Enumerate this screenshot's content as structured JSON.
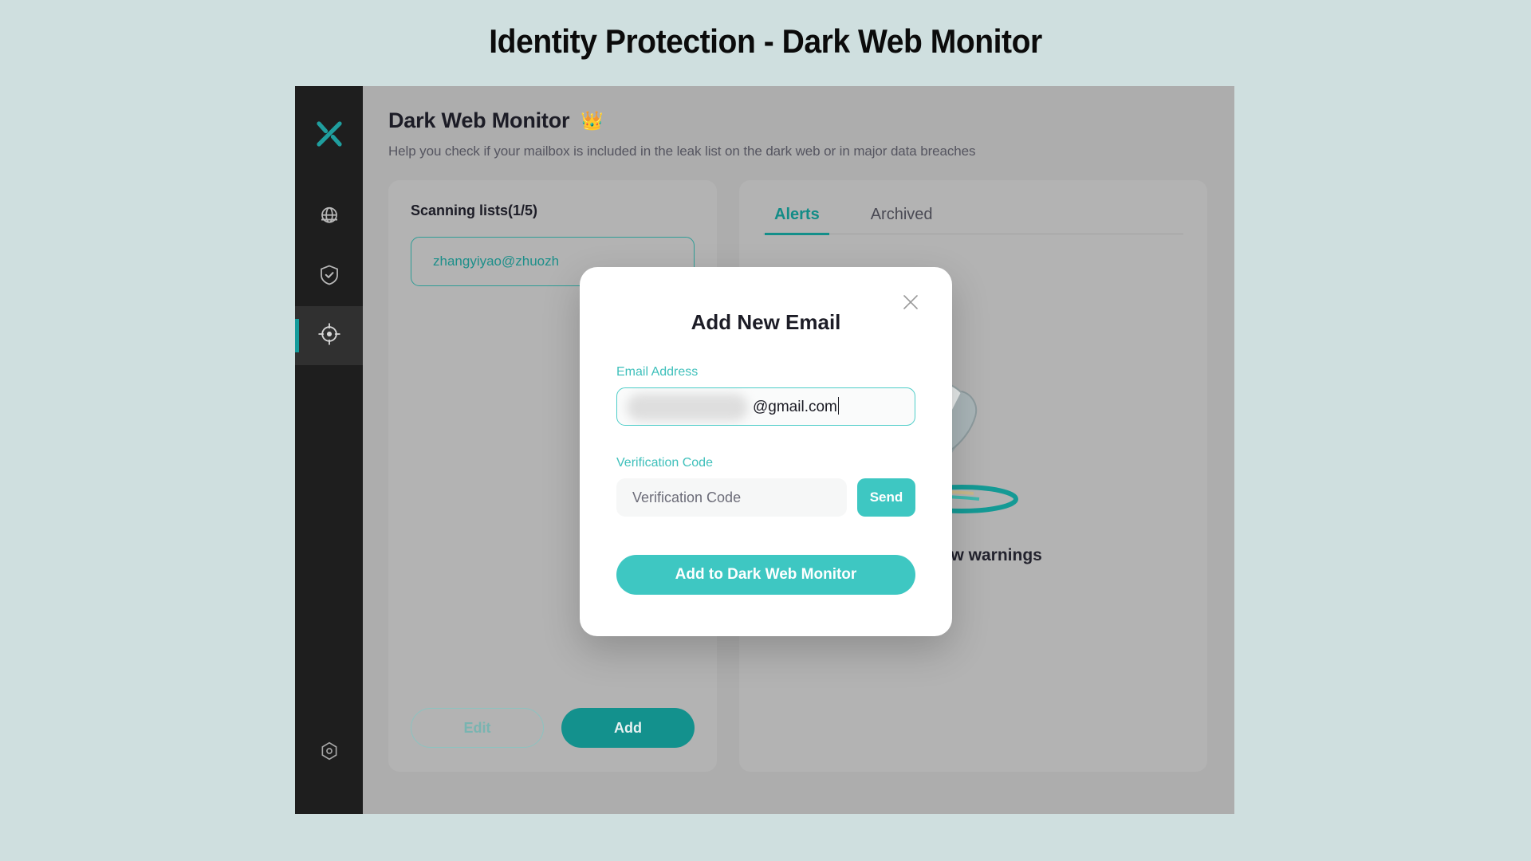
{
  "page": {
    "title": "Identity Protection - Dark Web Monitor",
    "background_color": "#cfdfdf"
  },
  "theme": {
    "accent": "#3ec7c2",
    "accent_dark": "#13918d",
    "sidebar_bg": "#1e1e1e",
    "panel_bg": "#b3b3b3",
    "app_bg": "#adadad"
  },
  "sidebar": {
    "logo": "x-logo-icon",
    "items": [
      {
        "icon": "globe-icon",
        "name": "globe",
        "active": false
      },
      {
        "icon": "shield-check-icon",
        "name": "shield-check",
        "active": false
      },
      {
        "icon": "target-crosshair-icon",
        "name": "dark-web-monitor",
        "active": true
      }
    ],
    "bottom_item": {
      "icon": "hexagon-settings-icon",
      "name": "settings"
    }
  },
  "header": {
    "title": "Dark Web Monitor",
    "badge_icon": "crown-icon",
    "badge_glyph": "👑",
    "subtitle": "Help you check if your mailbox is included in the leak list on the dark web or in major data breaches"
  },
  "left_panel": {
    "scanning_title": "Scanning lists(1/5)",
    "emails": [
      {
        "address": "zhangyiyao@zhuozh"
      }
    ],
    "edit_label": "Edit",
    "add_label": "Add"
  },
  "right_panel": {
    "tabs": [
      {
        "label": "Alerts",
        "active": true
      },
      {
        "label": "Archived",
        "active": false
      }
    ],
    "empty_state": {
      "illustration": "hand-magnifier-illustration",
      "text": "No new warnings"
    }
  },
  "modal": {
    "title": "Add New Email",
    "close_icon": "close-icon",
    "close_glyph": "✕",
    "email_label": "Email Address",
    "email_value": "@gmail.com",
    "email_redacted": true,
    "code_label": "Verification Code",
    "code_placeholder": "Verification Code",
    "code_value": "",
    "send_label": "Send",
    "submit_label": "Add to Dark Web Monitor"
  }
}
